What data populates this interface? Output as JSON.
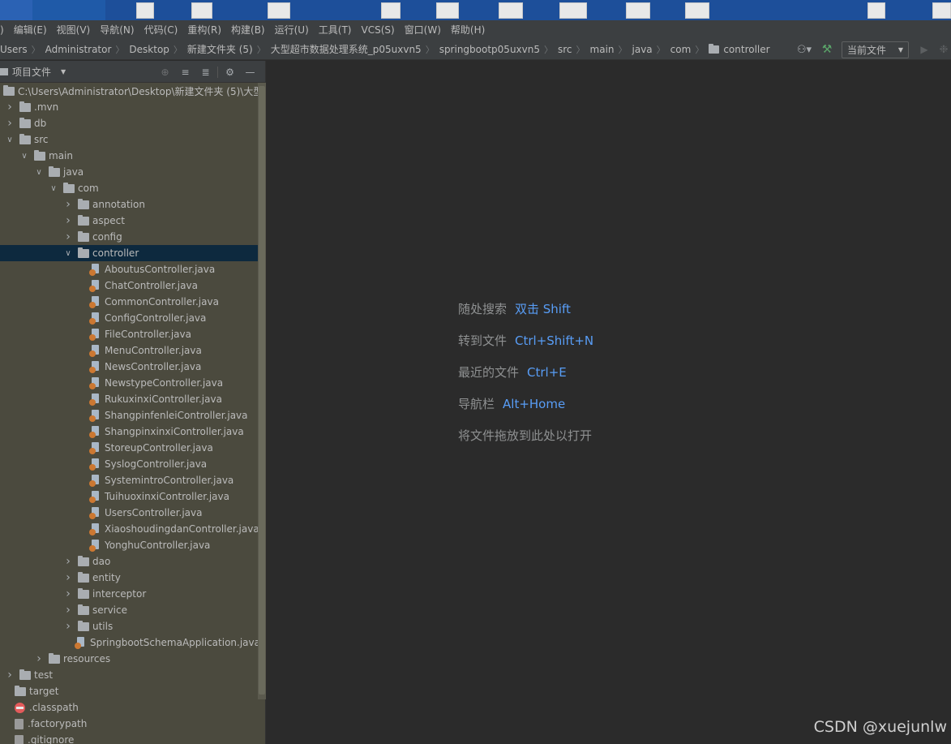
{
  "menu": [
    "编辑(E)",
    "视图(V)",
    "导航(N)",
    "代码(C)",
    "重构(R)",
    "构建(B)",
    "运行(U)",
    "工具(T)",
    "VCS(S)",
    "窗口(W)",
    "帮助(H)"
  ],
  "breadcrumbs": [
    "Users",
    "Administrator",
    "Desktop",
    "新建文件夹 (5)",
    "大型超市数据处理系统_p05uxvn5",
    "springbootp05uxvn5",
    "src",
    "main",
    "java",
    "com",
    "controller"
  ],
  "run_config": "当前文件",
  "project_panel": {
    "title": "项目文件",
    "root_path": "C:\\Users\\Administrator\\Desktop\\新建文件夹 (5)\\大型超"
  },
  "tree": [
    {
      "label": ".mvn",
      "type": "folder",
      "expanded": false
    },
    {
      "label": "db",
      "type": "folder",
      "expanded": false
    },
    {
      "label": "src",
      "type": "folder",
      "expanded": true
    },
    {
      "label": "main",
      "type": "folder",
      "expanded": true
    },
    {
      "label": "java",
      "type": "folder",
      "expanded": true
    },
    {
      "label": "com",
      "type": "folder",
      "expanded": true
    },
    {
      "label": "annotation",
      "type": "folder",
      "expanded": false
    },
    {
      "label": "aspect",
      "type": "folder",
      "expanded": false
    },
    {
      "label": "config",
      "type": "folder",
      "expanded": false
    },
    {
      "label": "controller",
      "type": "folder",
      "expanded": true,
      "selected": true
    },
    {
      "label": "AboutusController.java",
      "type": "java"
    },
    {
      "label": "ChatController.java",
      "type": "java"
    },
    {
      "label": "CommonController.java",
      "type": "java"
    },
    {
      "label": "ConfigController.java",
      "type": "java"
    },
    {
      "label": "FileController.java",
      "type": "java"
    },
    {
      "label": "MenuController.java",
      "type": "java"
    },
    {
      "label": "NewsController.java",
      "type": "java"
    },
    {
      "label": "NewstypeController.java",
      "type": "java"
    },
    {
      "label": "RukuxinxiController.java",
      "type": "java"
    },
    {
      "label": "ShangpinfenleiController.java",
      "type": "java"
    },
    {
      "label": "ShangpinxinxiController.java",
      "type": "java"
    },
    {
      "label": "StoreupController.java",
      "type": "java"
    },
    {
      "label": "SyslogController.java",
      "type": "java"
    },
    {
      "label": "SystemintroController.java",
      "type": "java"
    },
    {
      "label": "TuihuoxinxiController.java",
      "type": "java"
    },
    {
      "label": "UsersController.java",
      "type": "java"
    },
    {
      "label": "XiaoshoudingdanController.java",
      "type": "java"
    },
    {
      "label": "YonghuController.java",
      "type": "java"
    },
    {
      "label": "dao",
      "type": "folder",
      "expanded": false
    },
    {
      "label": "entity",
      "type": "folder",
      "expanded": false
    },
    {
      "label": "interceptor",
      "type": "folder",
      "expanded": false
    },
    {
      "label": "service",
      "type": "folder",
      "expanded": false
    },
    {
      "label": "utils",
      "type": "folder",
      "expanded": false
    },
    {
      "label": "SpringbootSchemaApplication.java",
      "type": "java"
    },
    {
      "label": "resources",
      "type": "folder",
      "expanded": false
    },
    {
      "label": "test",
      "type": "folder",
      "expanded": false
    },
    {
      "label": "target",
      "type": "folder",
      "leaf": true
    },
    {
      "label": ".classpath",
      "type": "classpath"
    },
    {
      "label": ".factorypath",
      "type": "file"
    },
    {
      "label": ".gitignore",
      "type": "file"
    }
  ],
  "editor_hints": [
    {
      "text": "随处搜索",
      "key": "双击 Shift"
    },
    {
      "text": "转到文件",
      "key": "Ctrl+Shift+N"
    },
    {
      "text": "最近的文件",
      "key": "Ctrl+E"
    },
    {
      "text": "导航栏",
      "key": "Alt+Home"
    },
    {
      "text": "将文件拖放到此处以打开",
      "key": ""
    }
  ],
  "watermark": "CSDN @xuejunlw",
  "colors": {
    "accent_key": "#589df6",
    "selection": "#0d293e",
    "panel_bg": "#4b4a3e"
  }
}
